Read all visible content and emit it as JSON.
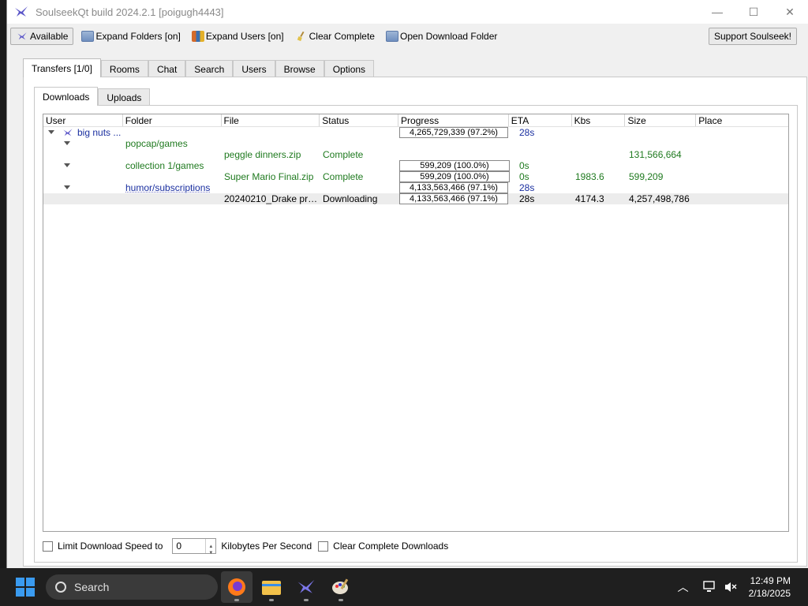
{
  "window": {
    "title": "SoulseekQt build 2024.2.1 [poigugh4443]",
    "controls": {
      "minimize": "—",
      "maximize": "☐",
      "close": "✕"
    }
  },
  "toolbar": {
    "available": "Available",
    "expand_folders": "Expand Folders [on]",
    "expand_users": "Expand Users [on]",
    "clear_complete": "Clear Complete",
    "open_download_folder": "Open Download Folder",
    "support": "Support Soulseek!"
  },
  "tabs": [
    "Transfers [1/0]",
    "Rooms",
    "Chat",
    "Search",
    "Users",
    "Browse",
    "Options"
  ],
  "subtabs": [
    "Downloads",
    "Uploads"
  ],
  "columns": [
    "User",
    "Folder",
    "File",
    "Status",
    "Progress",
    "ETA",
    "Kbs",
    "Size",
    "Place"
  ],
  "rows": [
    {
      "user": "big nuts ...",
      "progress": "4,265,729,339 (97.2%)",
      "eta": "28s"
    },
    {
      "folder": "popcap/games"
    },
    {
      "file": "peggle dinners.zip",
      "status": "Complete",
      "size": "131,566,664"
    },
    {
      "folder": "collection 1/games",
      "progress": "599,209 (100.0%)",
      "eta": "0s"
    },
    {
      "file": "Super Mario Final.zip",
      "status": "Complete",
      "progress": "599,209 (100.0%)",
      "eta": "0s",
      "kbs": "1983.6",
      "size": "599,209"
    },
    {
      "folder": "humor/subscriptions",
      "progress": "4,133,563,466 (97.1%)",
      "eta": "28s"
    },
    {
      "file": "20240210_Drake pres...",
      "status": "Downloading",
      "progress": "4,133,563,466 (97.1%)",
      "eta": "28s",
      "kbs": "4174.3",
      "size": "4,257,498,786"
    }
  ],
  "bottom": {
    "limit_label": "Limit Download Speed to",
    "speed_value": "0",
    "units": "Kilobytes Per Second",
    "clear_label": "Clear Complete Downloads"
  },
  "taskbar": {
    "search": "Search",
    "time": "12:49 PM",
    "date": "2/18/2025"
  }
}
